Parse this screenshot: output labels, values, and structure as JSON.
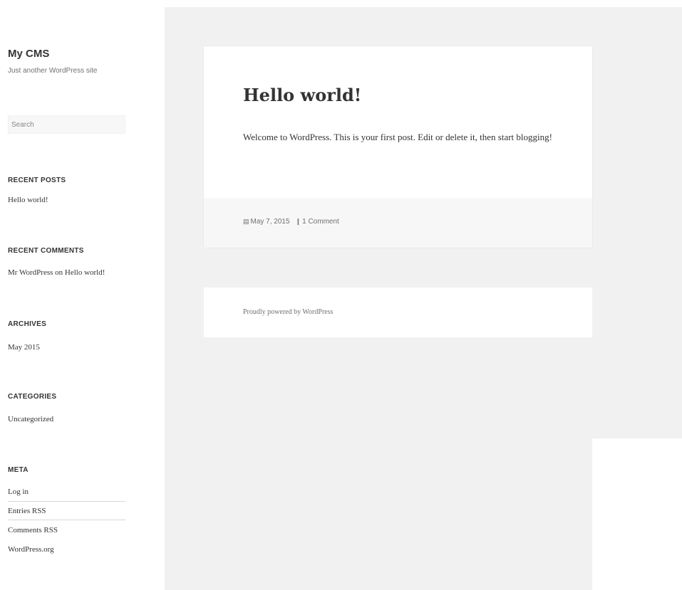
{
  "site": {
    "title": "My CMS",
    "description": "Just another WordPress site"
  },
  "search": {
    "placeholder": "Search"
  },
  "widgets": {
    "recent_posts": {
      "title": "RECENT POSTS",
      "items": [
        "Hello world!"
      ]
    },
    "recent_comments": {
      "title": "RECENT COMMENTS",
      "items": [
        "Mr WordPress on Hello world!"
      ]
    },
    "archives": {
      "title": "ARCHIVES",
      "items": [
        "May 2015"
      ]
    },
    "categories": {
      "title": "CATEGORIES",
      "items": [
        "Uncategorized"
      ]
    },
    "meta": {
      "title": "META",
      "items": [
        "Log in",
        "Entries RSS",
        "Comments RSS",
        "WordPress.org"
      ]
    }
  },
  "post": {
    "title": "Hello world!",
    "body": "Welcome to WordPress. This is your first post. Edit or delete it, then start blogging!",
    "date": "May 7, 2015",
    "comments": "1 Comment",
    "date_icon": "calendar-icon",
    "comment_icon": "comment-icon"
  },
  "footer": {
    "powered_by": "Proudly powered by WordPress"
  },
  "colors": {
    "content_background": "#f1f1f1",
    "card_background": "#ffffff",
    "card_footer_background": "#f7f7f7",
    "text": "#333333",
    "muted_text": "#707070"
  }
}
